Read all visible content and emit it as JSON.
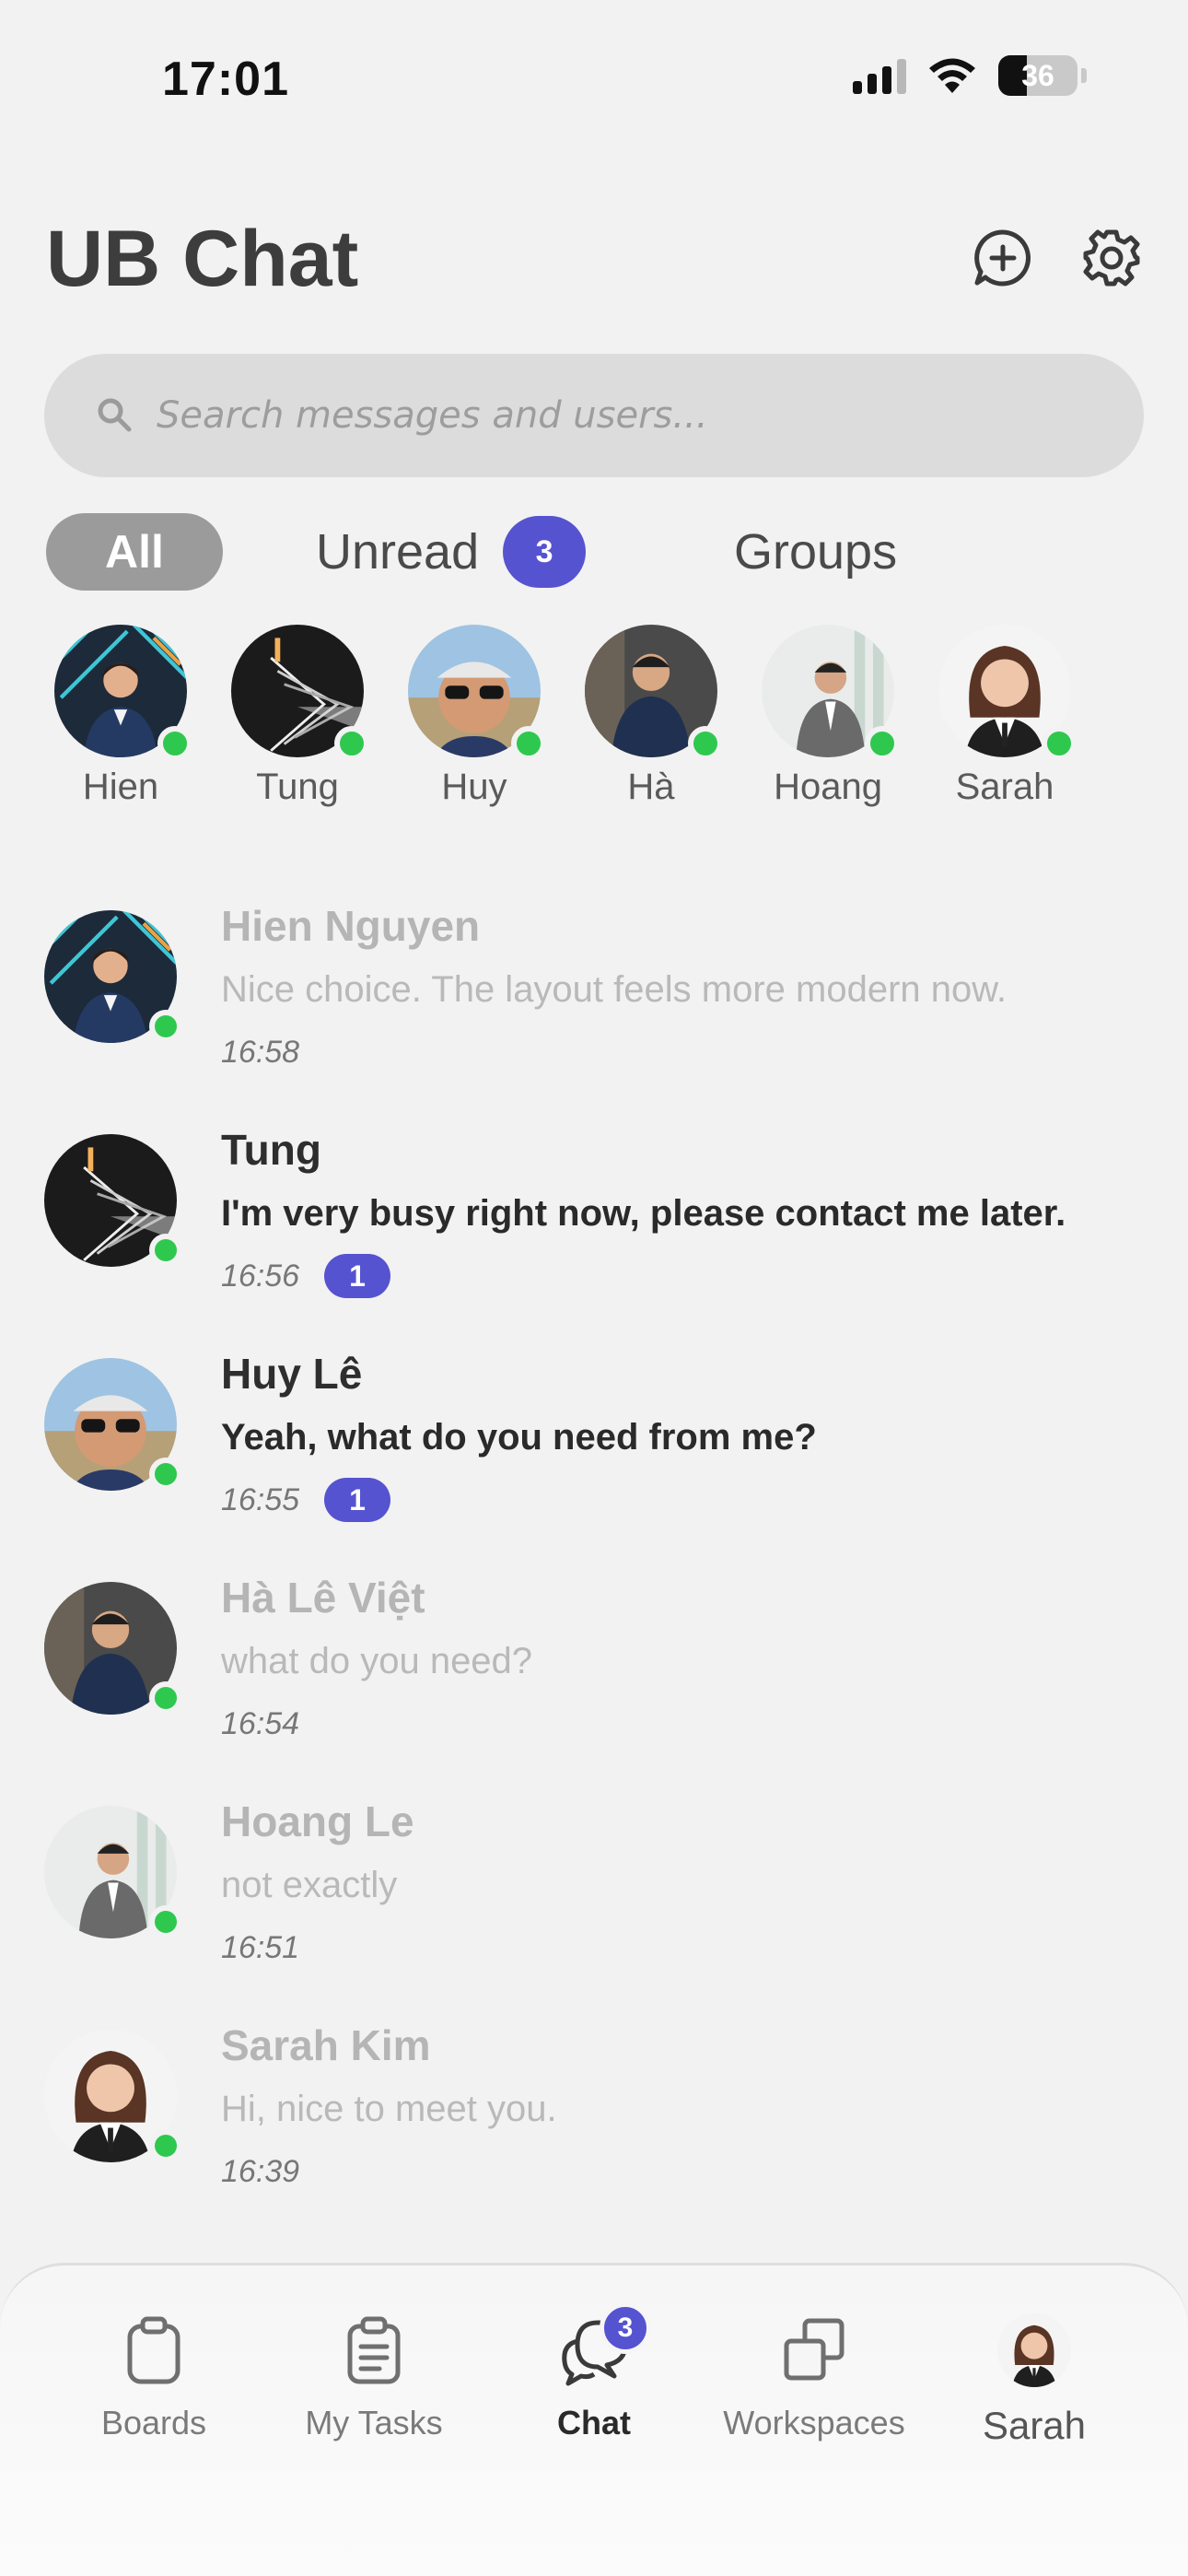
{
  "status_bar": {
    "time": "17:01",
    "battery": "36"
  },
  "header": {
    "title": "UB Chat",
    "new_chat_icon": "new-chat-icon",
    "settings_icon": "gear-icon"
  },
  "search": {
    "placeholder": "Search messages and users..."
  },
  "filters": {
    "all": "All",
    "unread": "Unread",
    "unread_count": "3",
    "groups": "Groups"
  },
  "stories": [
    {
      "name": "Hien"
    },
    {
      "name": "Tung"
    },
    {
      "name": "Huy"
    },
    {
      "name": "Hà"
    },
    {
      "name": "Hoang"
    },
    {
      "name": "Sarah"
    }
  ],
  "chats": [
    {
      "name": "Hien Nguyen",
      "message": "Nice choice. The layout feels more modern now.",
      "time": "16:58",
      "unread": ""
    },
    {
      "name": "Tung",
      "message": "I'm very busy right now, please contact me later.",
      "time": "16:56",
      "unread": "1"
    },
    {
      "name": "Huy Lê",
      "message": "Yeah, what do you need from me?",
      "time": "16:55",
      "unread": "1"
    },
    {
      "name": "Hà Lê Việt",
      "message": "what do you need?",
      "time": "16:54",
      "unread": ""
    },
    {
      "name": "Hoang Le",
      "message": "not exactly",
      "time": "16:51",
      "unread": ""
    },
    {
      "name": "Sarah Kim",
      "message": "Hi, nice to meet you.",
      "time": "16:39",
      "unread": ""
    }
  ],
  "bottom_nav": {
    "boards": "Boards",
    "my_tasks": "My Tasks",
    "chat": "Chat",
    "chat_badge": "3",
    "workspaces": "Workspaces",
    "profile": "Sarah"
  },
  "colors": {
    "accent": "#5553d0",
    "online": "#2fc84f",
    "background": "#f2f2f2"
  }
}
